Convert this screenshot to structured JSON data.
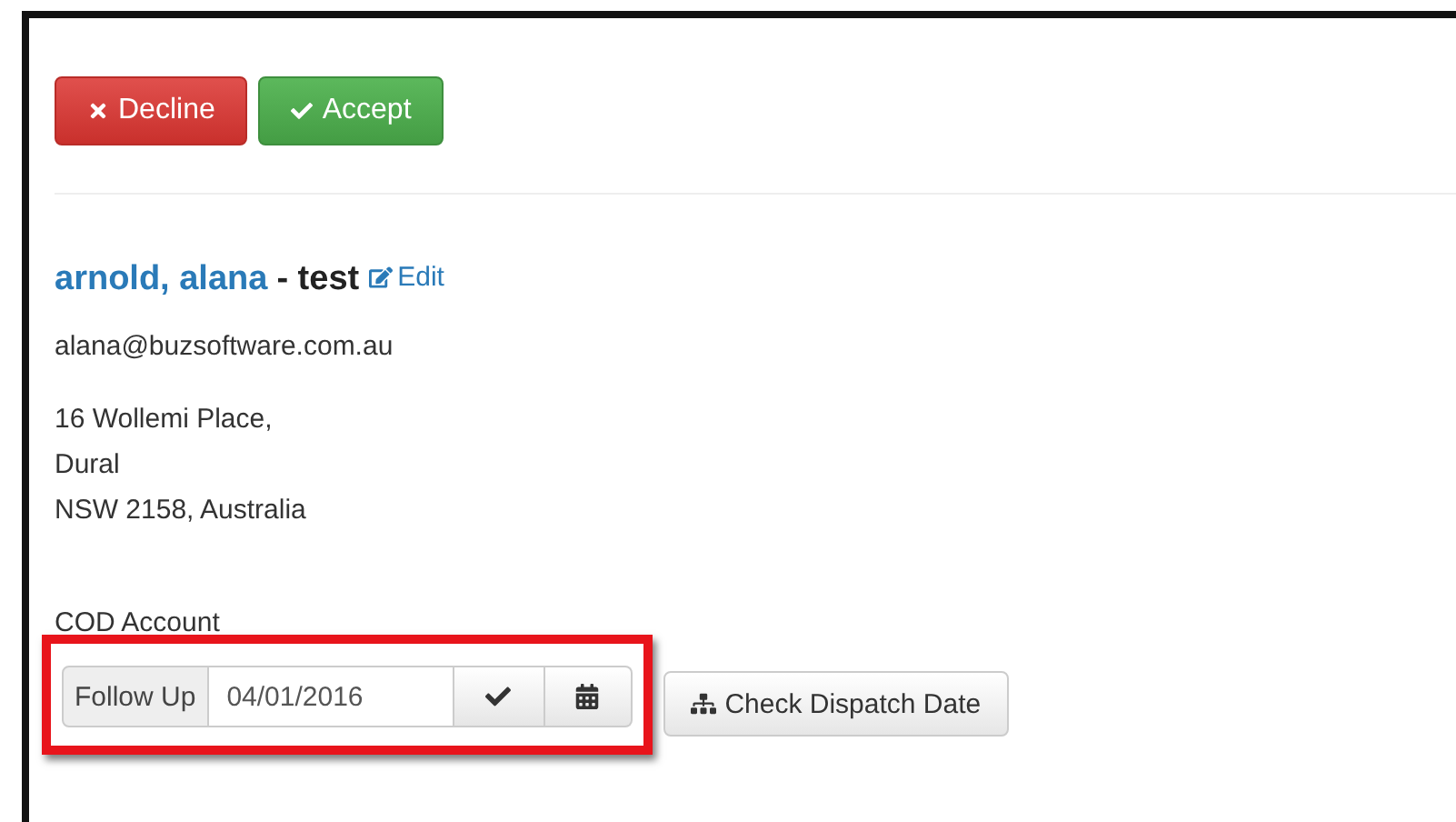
{
  "actions": [
    {
      "kind": "decline",
      "label": "Decline"
    },
    {
      "kind": "accept",
      "label": "Accept"
    }
  ],
  "customer": {
    "name": "arnold, alana",
    "suffix": "- test",
    "edit_label": "Edit",
    "email": "alana@buzsoftware.com.au",
    "address": [
      "16 Wollemi Place,",
      "Dural",
      "NSW 2158, Australia"
    ],
    "account_type": "COD Account"
  },
  "follow_up": {
    "label": "Follow Up",
    "value": "04/01/2016",
    "highlighted": true
  },
  "check_dispatch": {
    "label": "Check Dispatch Date"
  }
}
